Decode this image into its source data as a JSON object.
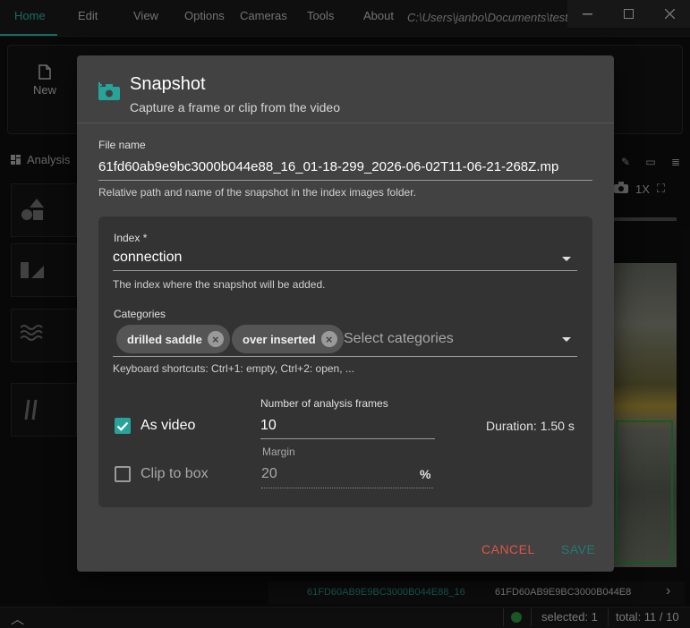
{
  "menubar": {
    "items": [
      "Home",
      "Edit",
      "View",
      "Options",
      "Cameras",
      "Tools",
      "About"
    ],
    "path": "C:\\Users\\janbo\\Documents\\testm"
  },
  "ribbon": {
    "new_label": "New"
  },
  "left_panel": {
    "title": "Analysis"
  },
  "viewer": {
    "zoom_label": "1X",
    "strip_items": [
      "61FD60AB9E9BC3000B044E88_16",
      "61FD60AB9E9BC3000B044E8"
    ]
  },
  "statusbar": {
    "selected": "selected: 1",
    "total": "total: 11 / 10"
  },
  "dialog": {
    "title": "Snapshot",
    "subtitle": "Capture a frame or clip from the video",
    "file_name": {
      "label": "File name",
      "value": "61fd60ab9e9bc3000b044e88_16_01-18-299_2026-06-02T11-06-21-268Z.mp",
      "help": "Relative path and name of the snapshot in the index images folder."
    },
    "index": {
      "label": "Index *",
      "value": "connection",
      "help": "The index where the snapshot will be added."
    },
    "categories": {
      "label": "Categories",
      "chips": [
        "drilled saddle",
        "over inserted"
      ],
      "placeholder": "Select categories",
      "help": "Keyboard shortcuts: Ctrl+1: empty, Ctrl+2: open, ..."
    },
    "as_video": {
      "label": "As video",
      "checked": true
    },
    "clip_to_box": {
      "label": "Clip to box",
      "checked": false
    },
    "frames": {
      "label": "Number of analysis frames",
      "value": "10"
    },
    "duration": "Duration: 1.50 s",
    "margin": {
      "label": "Margin",
      "value": "20",
      "unit": "%"
    },
    "cancel_label": "CANCEL",
    "save_label": "SAVE"
  },
  "colors": {
    "accent": "#2ec1b4",
    "cancel": "#e05545",
    "save_disabled": "#1f7d74",
    "status_green": "#2ea043"
  }
}
